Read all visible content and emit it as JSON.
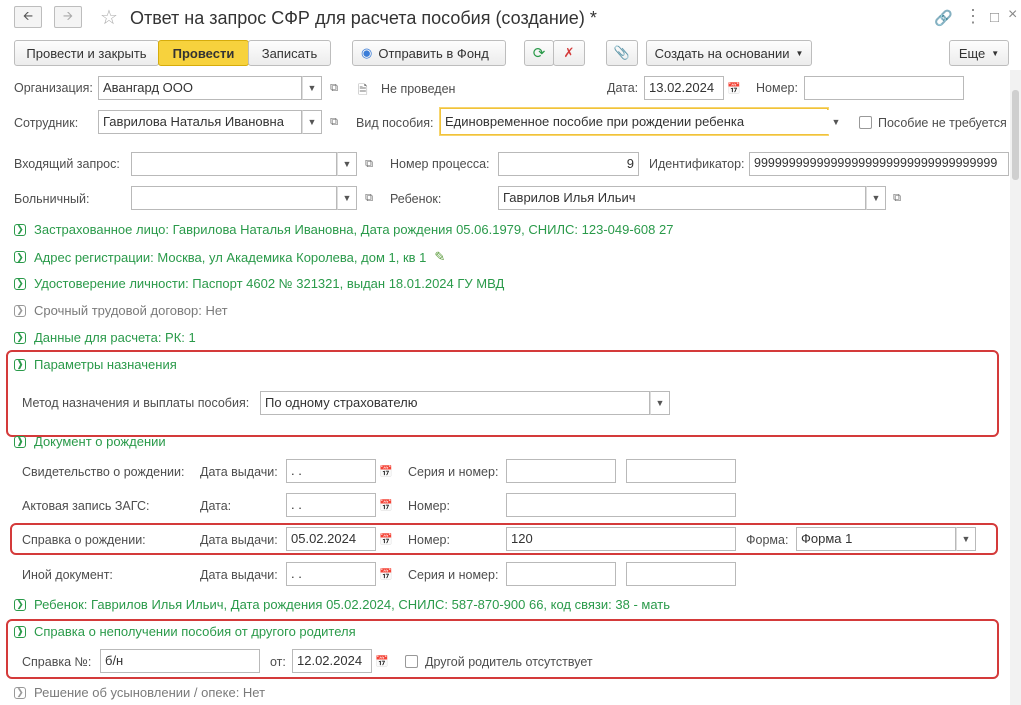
{
  "header": {
    "title": "Ответ на запрос СФР для расчета пособия (создание) *",
    "back_icon": "arrow-left-icon",
    "forward_icon": "arrow-right-icon",
    "favorite_icon": "star-icon",
    "link_icon": "link-icon",
    "menu_icon": "more-vertical-icon",
    "maximize_icon": "maximize-icon",
    "close_icon": "close-icon"
  },
  "toolbar": {
    "post_close": "Провести и закрыть",
    "post": "Провести",
    "save": "Записать",
    "send": "Отправить в Фонд",
    "create_based": "Создать на основании",
    "more": "Еще"
  },
  "form": {
    "org_label": "Организация:",
    "org_value": "Авангард ООО",
    "status": "Не проведен",
    "date_label": "Дата:",
    "date_value": "13.02.2024",
    "number_label": "Номер:",
    "number_value": "",
    "employee_label": "Сотрудник:",
    "employee_value": "Гаврилова Наталья Ивановна",
    "benefit_type_label": "Вид пособия:",
    "benefit_type_value": "Единовременное пособие при рождении ребенка",
    "no_benefit_label": "Пособие не требуется",
    "incoming_label": "Входящий запрос:",
    "incoming_value": "",
    "process_label": "Номер процесса:",
    "process_value": "9",
    "ident_label": "Идентификатор:",
    "ident_value": "99999999999999999999999999999999999",
    "sick_label": "Больничный:",
    "sick_value": "",
    "child_label": "Ребенок:",
    "child_value": "Гаврилов Илья Ильич"
  },
  "groups": {
    "insured": "Застрахованное лицо: Гаврилова Наталья Ивановна, Дата рождения 05.06.1979, СНИЛС: 123-049-608 27",
    "address": "Адрес регистрации: Москва, ул Академика Королева, дом 1, кв 1",
    "identity": "Удостоверение личности: Паспорт 4602 № 321321, выдан 18.01.2024 ГУ МВД",
    "contract": "Срочный трудовой договор: Нет",
    "calc": "Данные для расчета: РК: 1",
    "params": "Параметры назначения",
    "birth_doc": "Документ о рождении",
    "child_info": "Ребенок: Гаврилов Илья Ильич, Дата рождения 05.02.2024, СНИЛС: 587-870-900 66, код связи: 38 - мать",
    "non_receipt": "Справка о неполучении пособия от другого родителя",
    "adoption": "Решение об усыновлении / опеке: Нет"
  },
  "params": {
    "method_label": "Метод назначения и выплаты пособия:",
    "method_value": "По одному страхователю"
  },
  "birth": {
    "cert_label": "Свидетельство о рождении:",
    "issue_label": "Дата выдачи:",
    "series_label": "Серия и номер:",
    "empty_date": " .  .",
    "zags_label": "Актовая запись ЗАГС:",
    "date_label": "Дата:",
    "number_label": "Номер:",
    "spravka_label": "Справка о рождении:",
    "spravka_date": "05.02.2024",
    "spravka_number": "120",
    "form_label": "Форма:",
    "form_value": "Форма 1",
    "other_label": "Иной документ:"
  },
  "nonreceipt": {
    "num_label": "Справка №:",
    "num_value": "б/н",
    "from_label": "от:",
    "from_value": "12.02.2024",
    "absent_label": "Другой родитель отсутствует"
  }
}
